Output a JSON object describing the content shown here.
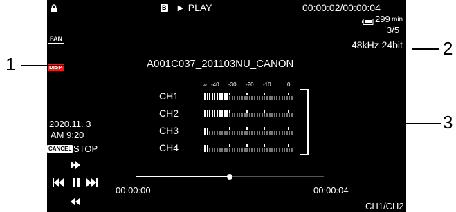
{
  "top": {
    "lock_icon": "lock-icon",
    "card_slot": "B",
    "mode": "► PLAY",
    "timecode": "00:00:02/00:00:04",
    "battery_minutes": "299",
    "battery_unit": "min",
    "clip_index": "3/5",
    "audio_format": "48kHz 24bit"
  },
  "left": {
    "fan_label": "FAN",
    "disp_label": "DISP",
    "date": "2020.11. 3",
    "time": "AM 9:20",
    "cancel_label": "CANCEL",
    "stop_label": "STOP"
  },
  "clip_name": "A001C037_201103NU_CANON",
  "meter": {
    "scale": [
      "∞",
      "-40",
      "-30",
      "-20",
      "-10",
      "0"
    ],
    "channels": [
      {
        "label": "CH1",
        "level": 0.28
      },
      {
        "label": "CH2",
        "level": 0.28
      },
      {
        "label": "CH3",
        "level": 0.05
      },
      {
        "label": "CH4",
        "level": 0.05
      }
    ]
  },
  "playback": {
    "start_time": "00:00:00",
    "end_time": "00:00:04",
    "progress": 0.5,
    "channel_output": "CH1/CH2"
  },
  "callouts": [
    "1",
    "2",
    "3"
  ],
  "colors": {
    "screen_bg": "#000000",
    "disp_badge": "#dd2222"
  }
}
